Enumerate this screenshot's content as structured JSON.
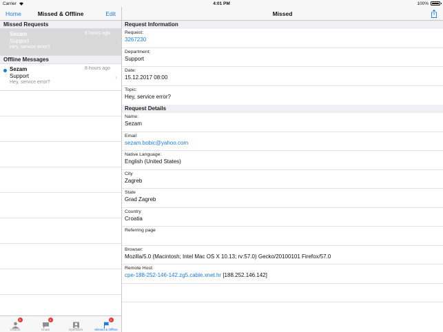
{
  "status": {
    "carrier": "Carrier",
    "time": "4:01 PM",
    "battery": "100%"
  },
  "master": {
    "nav": {
      "left": "Home",
      "title": "Missed & Offline",
      "right": "Edit"
    },
    "missed_header": "Missed Requests",
    "missed": [
      {
        "name": "Sezam",
        "dept": "Support",
        "message": "Hey, service error?",
        "time": "8 hours ago"
      }
    ],
    "offline_header": "Offline Messages",
    "offline": [
      {
        "name": "Sezam",
        "dept": "Support",
        "message": "Hey, service error?",
        "time": "8 hours ago"
      }
    ]
  },
  "tabs": [
    {
      "label": "Visitors",
      "badge": "1",
      "icon": "visitors-icon"
    },
    {
      "label": "Chats",
      "badge": "1",
      "icon": "chats-icon"
    },
    {
      "label": "Operators",
      "badge": "",
      "icon": "operators-icon"
    },
    {
      "label": "Missed & Offline",
      "badge": "1",
      "icon": "flag-icon"
    }
  ],
  "detail": {
    "title": "Missed",
    "request_info_header": "Request Information",
    "request_label": "Request:",
    "request_value": "3267230",
    "department_label": "Department:",
    "department_value": "Support",
    "date_label": "Date:",
    "date_value": "15.12.2017 08:00",
    "topic_label": "Topic:",
    "topic_value": "Hey, service error?",
    "request_details_header": "Request Details",
    "name_label": "Name:",
    "name_value": "Sezam",
    "email_label": "Email",
    "email_value": "sezam.bobic@yahoo.com",
    "language_label": "Native Language:",
    "language_value": "English (United States)",
    "city_label": "City",
    "city_value": "Zagreb",
    "state_label": "State",
    "state_value": "Grad Zagreb",
    "country_label": "Country",
    "country_value": "Croatia",
    "referring_label": "Referring page",
    "browser_label": "Browser:",
    "browser_value": "Mozilla/5.0 (Macintosh; Intel Mac OS X 10.13; rv:57.0) Gecko/20100101 Firefox/57.0",
    "host_label": "Remote Host:",
    "host_link": "cpe-188-252-146-142.zg5.cable.xnet.hr",
    "host_ip": "[188.252.146.142]"
  },
  "colors": {
    "accent": "#1a7ce0",
    "badge": "#e53935",
    "section_bg": "#efeff4",
    "selected_row": "#d9d9d9"
  }
}
